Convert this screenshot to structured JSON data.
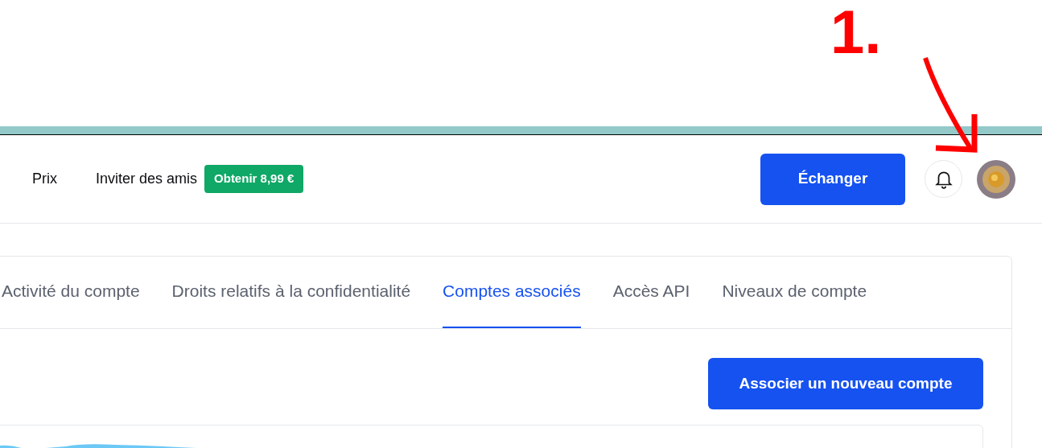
{
  "annotation": {
    "label": "1."
  },
  "nav": {
    "links": [
      "Prix",
      "Inviter des amis"
    ],
    "badge": "Obtenir 8,99 €",
    "primary_button": "Échanger"
  },
  "tabs": [
    {
      "label": "Activité du compte",
      "selected": false
    },
    {
      "label": "Droits relatifs à la confidentialité",
      "selected": false
    },
    {
      "label": "Comptes associés",
      "selected": true
    },
    {
      "label": "Accès API",
      "selected": false
    },
    {
      "label": "Niveaux de compte",
      "selected": false
    }
  ],
  "action_button": "Associer un nouveau compte"
}
